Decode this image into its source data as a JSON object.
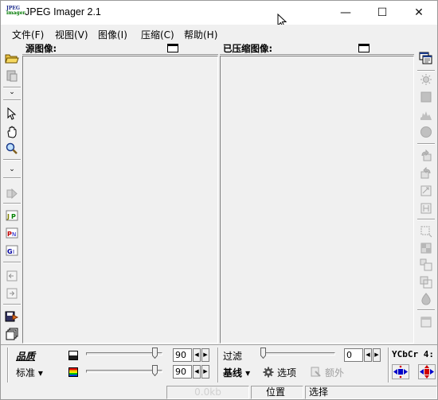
{
  "window": {
    "title": "JPEG Imager 2.1",
    "logo_text_top": "JPEG",
    "logo_text_bottom": "imager",
    "minimize": "—",
    "maximize": "☐",
    "close": "✕"
  },
  "menu": [
    {
      "label": "文件(F)"
    },
    {
      "label": "视图(V)"
    },
    {
      "label": "图像(I)"
    },
    {
      "label": "压缩(C)"
    },
    {
      "label": "帮助(H)"
    }
  ],
  "panes": {
    "source_title": "源图像:",
    "compressed_title": "已压缩图像:"
  },
  "bottom": {
    "quality_label": "品质",
    "preset_label": "标准 ▾",
    "quality_value": "90",
    "quality_value2": "90",
    "quality_level": 0.9,
    "filter_label": "过滤",
    "filter_value": "0",
    "filter_level": 0.0,
    "mode_label": "基线 ▾",
    "options_label": "选项",
    "extra_label": "额外",
    "ycbcr_label": "YCbCr 4:"
  },
  "status": {
    "size": "0.0kb",
    "position": "位置",
    "selection": "选择"
  },
  "colors": {
    "logo_blue": "#1a2a8a",
    "logo_green": "#007a00",
    "accent_red": "#d00000",
    "accent_blue": "#0000c8"
  }
}
